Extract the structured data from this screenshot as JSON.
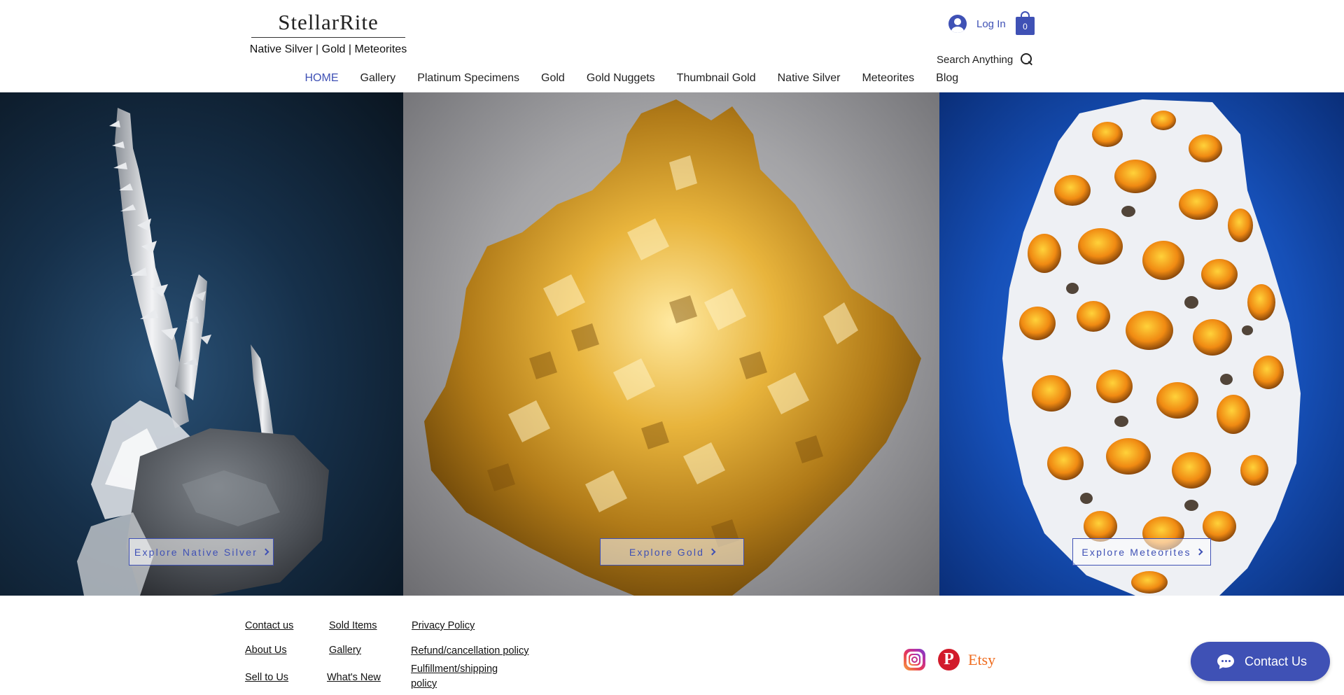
{
  "brand": {
    "title": "StellarRite",
    "tagline": "Native Silver | Gold | Meteorites"
  },
  "account": {
    "login_label": "Log In"
  },
  "cart": {
    "count": "0"
  },
  "search": {
    "label": "Search Anything"
  },
  "nav": {
    "items": [
      {
        "label": "HOME",
        "active": true
      },
      {
        "label": "Gallery"
      },
      {
        "label": "Platinum Specimens"
      },
      {
        "label": "Gold"
      },
      {
        "label": "Gold Nuggets"
      },
      {
        "label": "Thumbnail Gold"
      },
      {
        "label": "Native Silver"
      },
      {
        "label": "Meteorites"
      },
      {
        "label": "Blog"
      }
    ]
  },
  "hero": {
    "silver_button": "Explore Native Silver",
    "gold_button": "Explore Gold",
    "meteorite_button": "Explore Meteorites"
  },
  "footer": {
    "links": {
      "contact_us": "Contact us",
      "about_us": "About Us",
      "sell_to_us": "Sell to Us",
      "sold_items": "Sold Items",
      "gallery": "Gallery",
      "whats_new": "What's New",
      "privacy_policy": "Privacy Policy",
      "refund_policy": "Refund/cancellation policy",
      "fulfillment_policy_line1": "Fulfillment/shipping",
      "fulfillment_policy_line2": "policy"
    },
    "social": {
      "pinterest_glyph": "P",
      "etsy_label": "Etsy"
    },
    "contact_button": "Contact Us"
  },
  "colors": {
    "accent": "#3f51b5",
    "pinterest": "#d21b2b",
    "etsy": "#ef6c1f"
  }
}
